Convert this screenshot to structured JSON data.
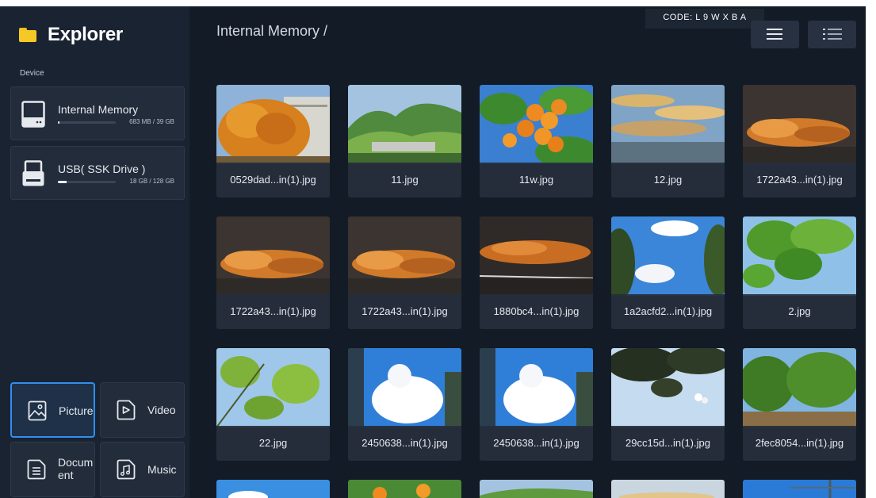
{
  "app": {
    "title": "Explorer"
  },
  "sidebar": {
    "section_label": "Device",
    "devices": [
      {
        "name": "Internal Memory",
        "size": "683 MB / 39 GB",
        "used_fraction": 0.03
      },
      {
        "name": "USB( SSK Drive )",
        "size": "18 GB / 128 GB",
        "used_fraction": 0.15
      }
    ],
    "categories": [
      {
        "label": "Picture",
        "active": true,
        "icon": "picture-icon"
      },
      {
        "label": "Video",
        "active": false,
        "icon": "video-icon"
      },
      {
        "label": "Docum\nent",
        "active": false,
        "icon": "document-icon"
      },
      {
        "label": "Music",
        "active": false,
        "icon": "music-icon"
      }
    ]
  },
  "main": {
    "breadcrumb": "Internal Memory /",
    "code": "CODE: L 9 W X B A",
    "view_buttons": [
      {
        "icon": "grid-view-icon"
      },
      {
        "icon": "list-view-icon"
      }
    ],
    "files": [
      {
        "name": "0529dad...in(1).jpg",
        "image": "autumn tree"
      },
      {
        "name": "11.jpg",
        "image": "green hills"
      },
      {
        "name": "11w.jpg",
        "image": "oranges"
      },
      {
        "name": "12.jpg",
        "image": "sunset clouds"
      },
      {
        "name": "1722a43...in(1).jpg",
        "image": "orange clouds"
      },
      {
        "name": "1722a43...in(1).jpg",
        "image": "orange clouds"
      },
      {
        "name": "1722a43...in(1).jpg",
        "image": "orange clouds"
      },
      {
        "name": "1880bc4...in(1).jpg",
        "image": "orange clouds"
      },
      {
        "name": "1a2acfd2...in(1).jpg",
        "image": "blue sky trees"
      },
      {
        "name": "2.jpg",
        "image": "green leaves"
      },
      {
        "name": "22.jpg",
        "image": "branches sky"
      },
      {
        "name": "2450638...in(1).jpg",
        "image": "cloud building"
      },
      {
        "name": "2450638...in(1).jpg",
        "image": "cloud building"
      },
      {
        "name": "29cc15d...in(1).jpg",
        "image": "flowers branches"
      },
      {
        "name": "2fec8054...in(1).jpg",
        "image": "green trees"
      }
    ]
  }
}
